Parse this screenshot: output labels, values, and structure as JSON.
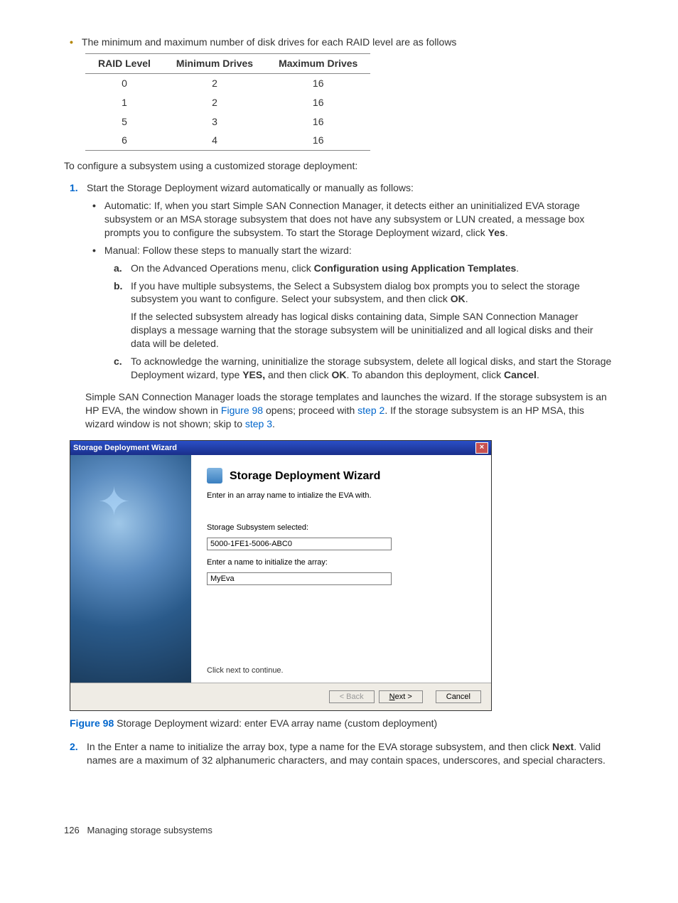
{
  "top_bullet": "The minimum and maximum number of disk drives for each RAID level are as follows",
  "table": {
    "headers": [
      "RAID Level",
      "Minimum Drives",
      "Maximum Drives"
    ],
    "rows": [
      [
        "0",
        "2",
        "16"
      ],
      [
        "1",
        "2",
        "16"
      ],
      [
        "5",
        "3",
        "16"
      ],
      [
        "6",
        "4",
        "16"
      ]
    ]
  },
  "intro": "To configure a subsystem using a customized storage deployment:",
  "step1": {
    "num": "1.",
    "text": "Start the Storage Deployment wizard automatically or manually as follows:",
    "auto_prefix": "Automatic: If, when you start Simple SAN Connection Manager, it detects either an uninitialized EVA storage subsystem or an MSA storage subsystem that does not have any subsystem or LUN created, a message box prompts you to configure the subsystem. To start the Storage Deployment wizard, click ",
    "auto_bold": "Yes",
    "auto_suffix": ".",
    "manual_text": "Manual: Follow these steps to manually start the wizard:",
    "a": {
      "mark": "a.",
      "prefix": "On the Advanced Operations menu, click ",
      "bold": "Configuration using Application Templates",
      "suffix": "."
    },
    "b": {
      "mark": "b.",
      "p1_prefix": "If you have multiple subsystems, the Select a Subsystem dialog box prompts you to select the storage subsystem you want to configure. Select your subsystem, and then click ",
      "p1_bold": "OK",
      "p1_suffix": ".",
      "p2": "If the selected subsystem already has logical disks containing data, Simple SAN Connection Manager displays a message warning that the storage subsystem will be uninitialized and all logical disks and their data will be deleted."
    },
    "c": {
      "mark": "c.",
      "prefix": "To acknowledge the warning, uninitialize the storage subsystem, delete all logical disks, and start the Storage Deployment wizard, type ",
      "b1": "YES,",
      "mid1": " and then click ",
      "b2": "OK",
      "mid2": ". To abandon this deployment, click ",
      "b3": "Cancel",
      "suffix": "."
    },
    "tail_prefix": "Simple SAN Connection Manager loads the storage templates and launches the wizard. If the storage subsystem is an HP EVA, the window shown in ",
    "tail_link1": "Figure 98",
    "tail_mid1": " opens; proceed with ",
    "tail_link2": "step 2",
    "tail_mid2": ". If the storage subsystem is an HP MSA, this wizard window is not shown; skip to ",
    "tail_link3": "step 3",
    "tail_suffix": "."
  },
  "wizard": {
    "title": "Storage Deployment Wizard",
    "heading": "Storage Deployment Wizard",
    "desc": "Enter in an array name to intialize the EVA with.",
    "label1": "Storage Subsystem selected:",
    "value1": "5000-1FE1-5006-ABC0",
    "label2": "Enter a name to initialize the array:",
    "value2": "MyEva",
    "continue": "Click next to continue.",
    "back": "< Back",
    "next": "Next >",
    "cancel": "Cancel"
  },
  "figure": {
    "num": "Figure 98",
    "caption": " Storage Deployment wizard: enter EVA array name (custom deployment)"
  },
  "step2": {
    "num": "2.",
    "prefix": "In the Enter a name to initialize the array box, type a name for the EVA storage subsystem, and then click ",
    "bold": "Next",
    "suffix": ". Valid names are a maximum of 32 alphanumeric characters, and may contain spaces, underscores, and special characters."
  },
  "footer": {
    "page": "126",
    "section": "Managing storage subsystems"
  }
}
